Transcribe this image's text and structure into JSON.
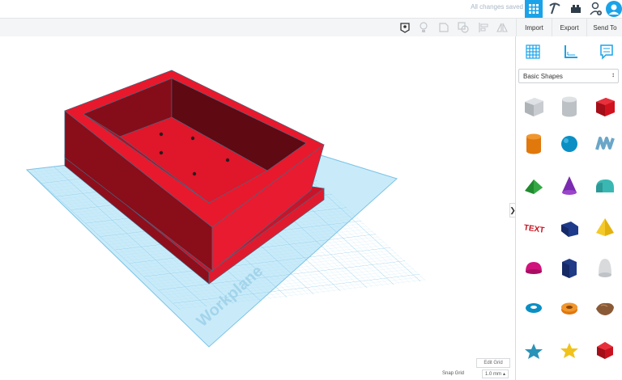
{
  "header": {
    "status": "All changes saved",
    "icons": [
      "grid-view-icon",
      "pickaxe-icon",
      "brick-icon",
      "add-user-icon",
      "user-avatar-icon"
    ]
  },
  "toolbar": {
    "tools": [
      "note-icon",
      "light-bulb-icon",
      "group-icon",
      "ungroup-icon",
      "align-icon",
      "mirror-icon"
    ],
    "import_label": "Import",
    "export_label": "Export",
    "sendto_label": "Send To"
  },
  "workplane": {
    "label": "Workplane"
  },
  "panel": {
    "tabs": [
      "grid-tab-icon",
      "ruler-tab-icon",
      "notes-tab-icon"
    ],
    "library": "Basic Shapes",
    "shapes": [
      "box-hole",
      "cylinder-hole",
      "box",
      "cylinder",
      "sphere",
      "scribble",
      "roof",
      "cone",
      "round-roof",
      "text",
      "half-cylinder",
      "pyramid",
      "half-sphere",
      "polygon",
      "paraboloid",
      "torus",
      "tube",
      "shape-generator",
      "star",
      "star-gold",
      "icosahedron"
    ]
  },
  "grid": {
    "edit_label": "Edit Grid",
    "snap_label": "Snap Grid",
    "snap_value": "1.0 mm"
  },
  "colors": {
    "accent": "#1aa3e8",
    "object": "#e0162b",
    "workplane": "#bfe6f7"
  }
}
